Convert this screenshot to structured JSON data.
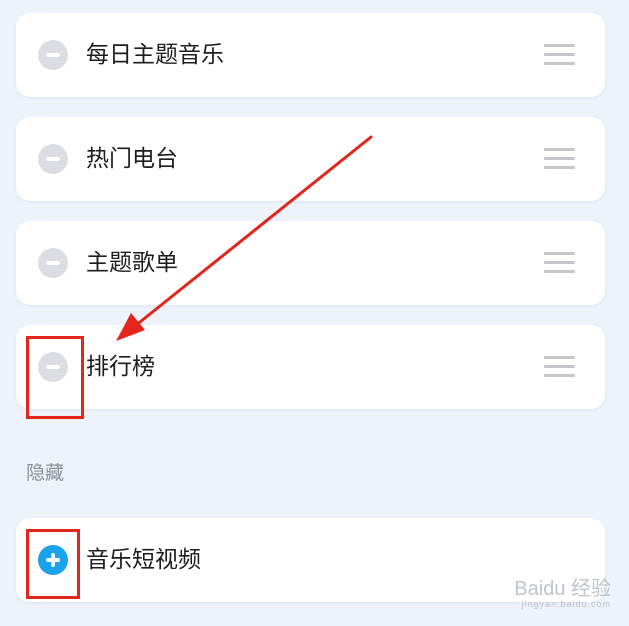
{
  "items": [
    {
      "label": "每日主题音乐"
    },
    {
      "label": "热门电台"
    },
    {
      "label": "主题歌单"
    },
    {
      "label": "排行榜"
    }
  ],
  "hidden_section": {
    "title": "隐藏",
    "items": [
      {
        "label": "音乐短视频"
      }
    ]
  },
  "icons": {
    "remove": "minus-circle-icon",
    "add": "plus-circle-icon",
    "drag": "drag-handle-icon"
  },
  "colors": {
    "remove_button": "#dcdde2",
    "add_button": "#1aa3e8",
    "highlight_annotation": "#e3251c",
    "background": "#eef3fa"
  },
  "watermark": {
    "text": "Baidu 经验",
    "subtext": "jingyan.baidu.com"
  }
}
